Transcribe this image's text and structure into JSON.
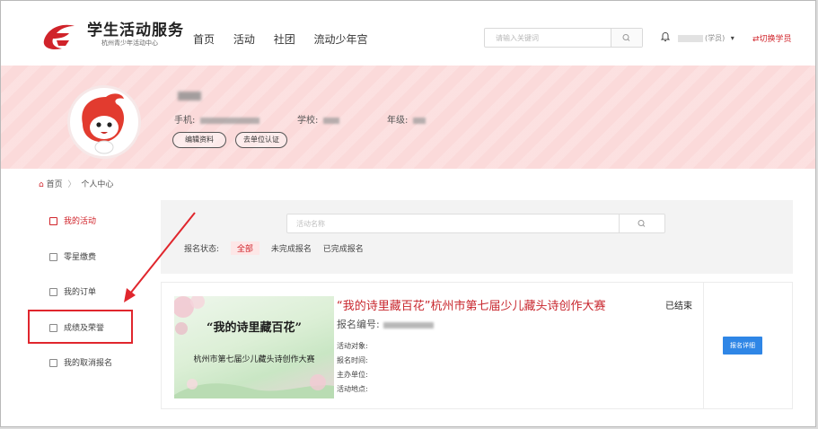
{
  "header": {
    "logo_title": "学生活动服务",
    "logo_subtitle": "杭州青少年活动中心",
    "nav": [
      "首页",
      "活动",
      "社团",
      "流动少年宫"
    ],
    "search_placeholder": "请输入关键词",
    "user_role": "(学员)",
    "switch_label": "⇄切换学员"
  },
  "profile": {
    "phone_label": "手机:",
    "school_label": "学校:",
    "grade_label": "年级:",
    "edit_button": "编辑资料",
    "verify_button": "去单位认证"
  },
  "breadcrumb": {
    "home": "首页",
    "separator": "〉",
    "current": "个人中心"
  },
  "sidebar": {
    "items": [
      {
        "label": "我的活动",
        "active": true
      },
      {
        "label": "零星缴费",
        "active": false
      },
      {
        "label": "我的订单",
        "active": false
      },
      {
        "label": "成绩及荣誉",
        "active": false
      },
      {
        "label": "我的取消报名",
        "active": false
      }
    ]
  },
  "filter": {
    "search_placeholder": "活动名称",
    "status_label": "报名状态:",
    "options": [
      "全部",
      "未完成报名",
      "已完成报名"
    ],
    "selected": "全部"
  },
  "activity": {
    "title": "“我的诗里藏百花”杭州市第七届少儿藏头诗创作大赛",
    "status": "已结束",
    "reg_no_label": "报名编号:",
    "poster_line1": "“我的诗里藏百花”",
    "poster_line2": "杭州市第七届少儿藏头诗创作大赛",
    "fields": [
      "活动对象:",
      "报名时间:",
      "主办单位:",
      "活动地点:"
    ],
    "detail_button": "报名详细"
  },
  "colors": {
    "accent": "#d0232a",
    "banner": "#fbdada",
    "button_blue": "#2f86e6",
    "highlight": "#e0262d"
  },
  "icons": [
    "logo-mark-icon",
    "search-icon",
    "bell-icon",
    "home-icon",
    "calendar-icon",
    "wallet-icon",
    "order-icon",
    "trophy-icon",
    "cancel-icon"
  ]
}
